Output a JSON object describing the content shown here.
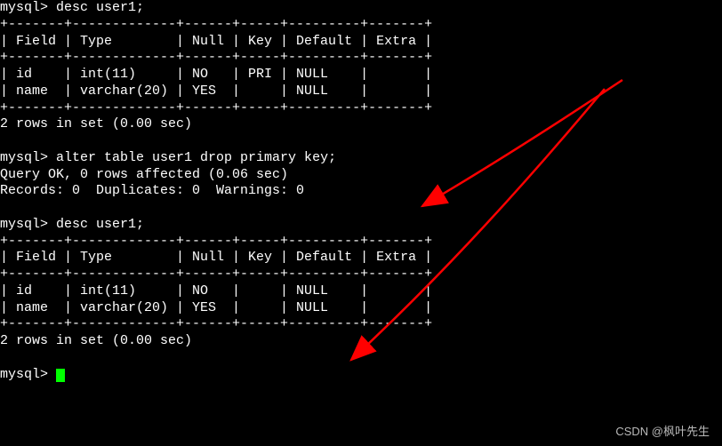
{
  "prompt": "mysql> ",
  "commands": {
    "desc1": "desc user1;",
    "alter": "alter table user1 drop primary key;",
    "desc2": "desc user1;",
    "empty": ""
  },
  "table1": {
    "sep": "+-------+-------------+------+-----+---------+-------+",
    "header": "| Field | Type        | Null | Key | Default | Extra |",
    "row1": "| id    | int(11)     | NO   | PRI | NULL    |       |",
    "row2": "| name  | varchar(20) | YES  |     | NULL    |       |"
  },
  "table2": {
    "sep": "+-------+-------------+------+-----+---------+-------+",
    "header": "| Field | Type        | Null | Key | Default | Extra |",
    "row1": "| id    | int(11)     | NO   |     | NULL    |       |",
    "row2": "| name  | varchar(20) | YES  |     | NULL    |       |"
  },
  "result_rows": "2 rows in set (0.00 sec)",
  "alter_result1": "Query OK, 0 rows affected (0.06 sec)",
  "alter_result2": "Records: 0  Duplicates: 0  Warnings: 0",
  "watermark": "CSDN @枫叶先生",
  "chart_data": {
    "type": "table",
    "title": "MySQL DESCRIBE user1 before and after dropping primary key",
    "before": {
      "columns": [
        "Field",
        "Type",
        "Null",
        "Key",
        "Default",
        "Extra"
      ],
      "rows": [
        [
          "id",
          "int(11)",
          "NO",
          "PRI",
          "NULL",
          ""
        ],
        [
          "name",
          "varchar(20)",
          "YES",
          "",
          "NULL",
          ""
        ]
      ]
    },
    "after": {
      "columns": [
        "Field",
        "Type",
        "Null",
        "Key",
        "Default",
        "Extra"
      ],
      "rows": [
        [
          "id",
          "int(11)",
          "NO",
          "",
          "NULL",
          ""
        ],
        [
          "name",
          "varchar(20)",
          "YES",
          "",
          "NULL",
          ""
        ]
      ]
    },
    "sql_command": "alter table user1 drop primary key;",
    "row_count": 2,
    "elapsed_sec": 0.0,
    "alter_elapsed_sec": 0.06
  }
}
